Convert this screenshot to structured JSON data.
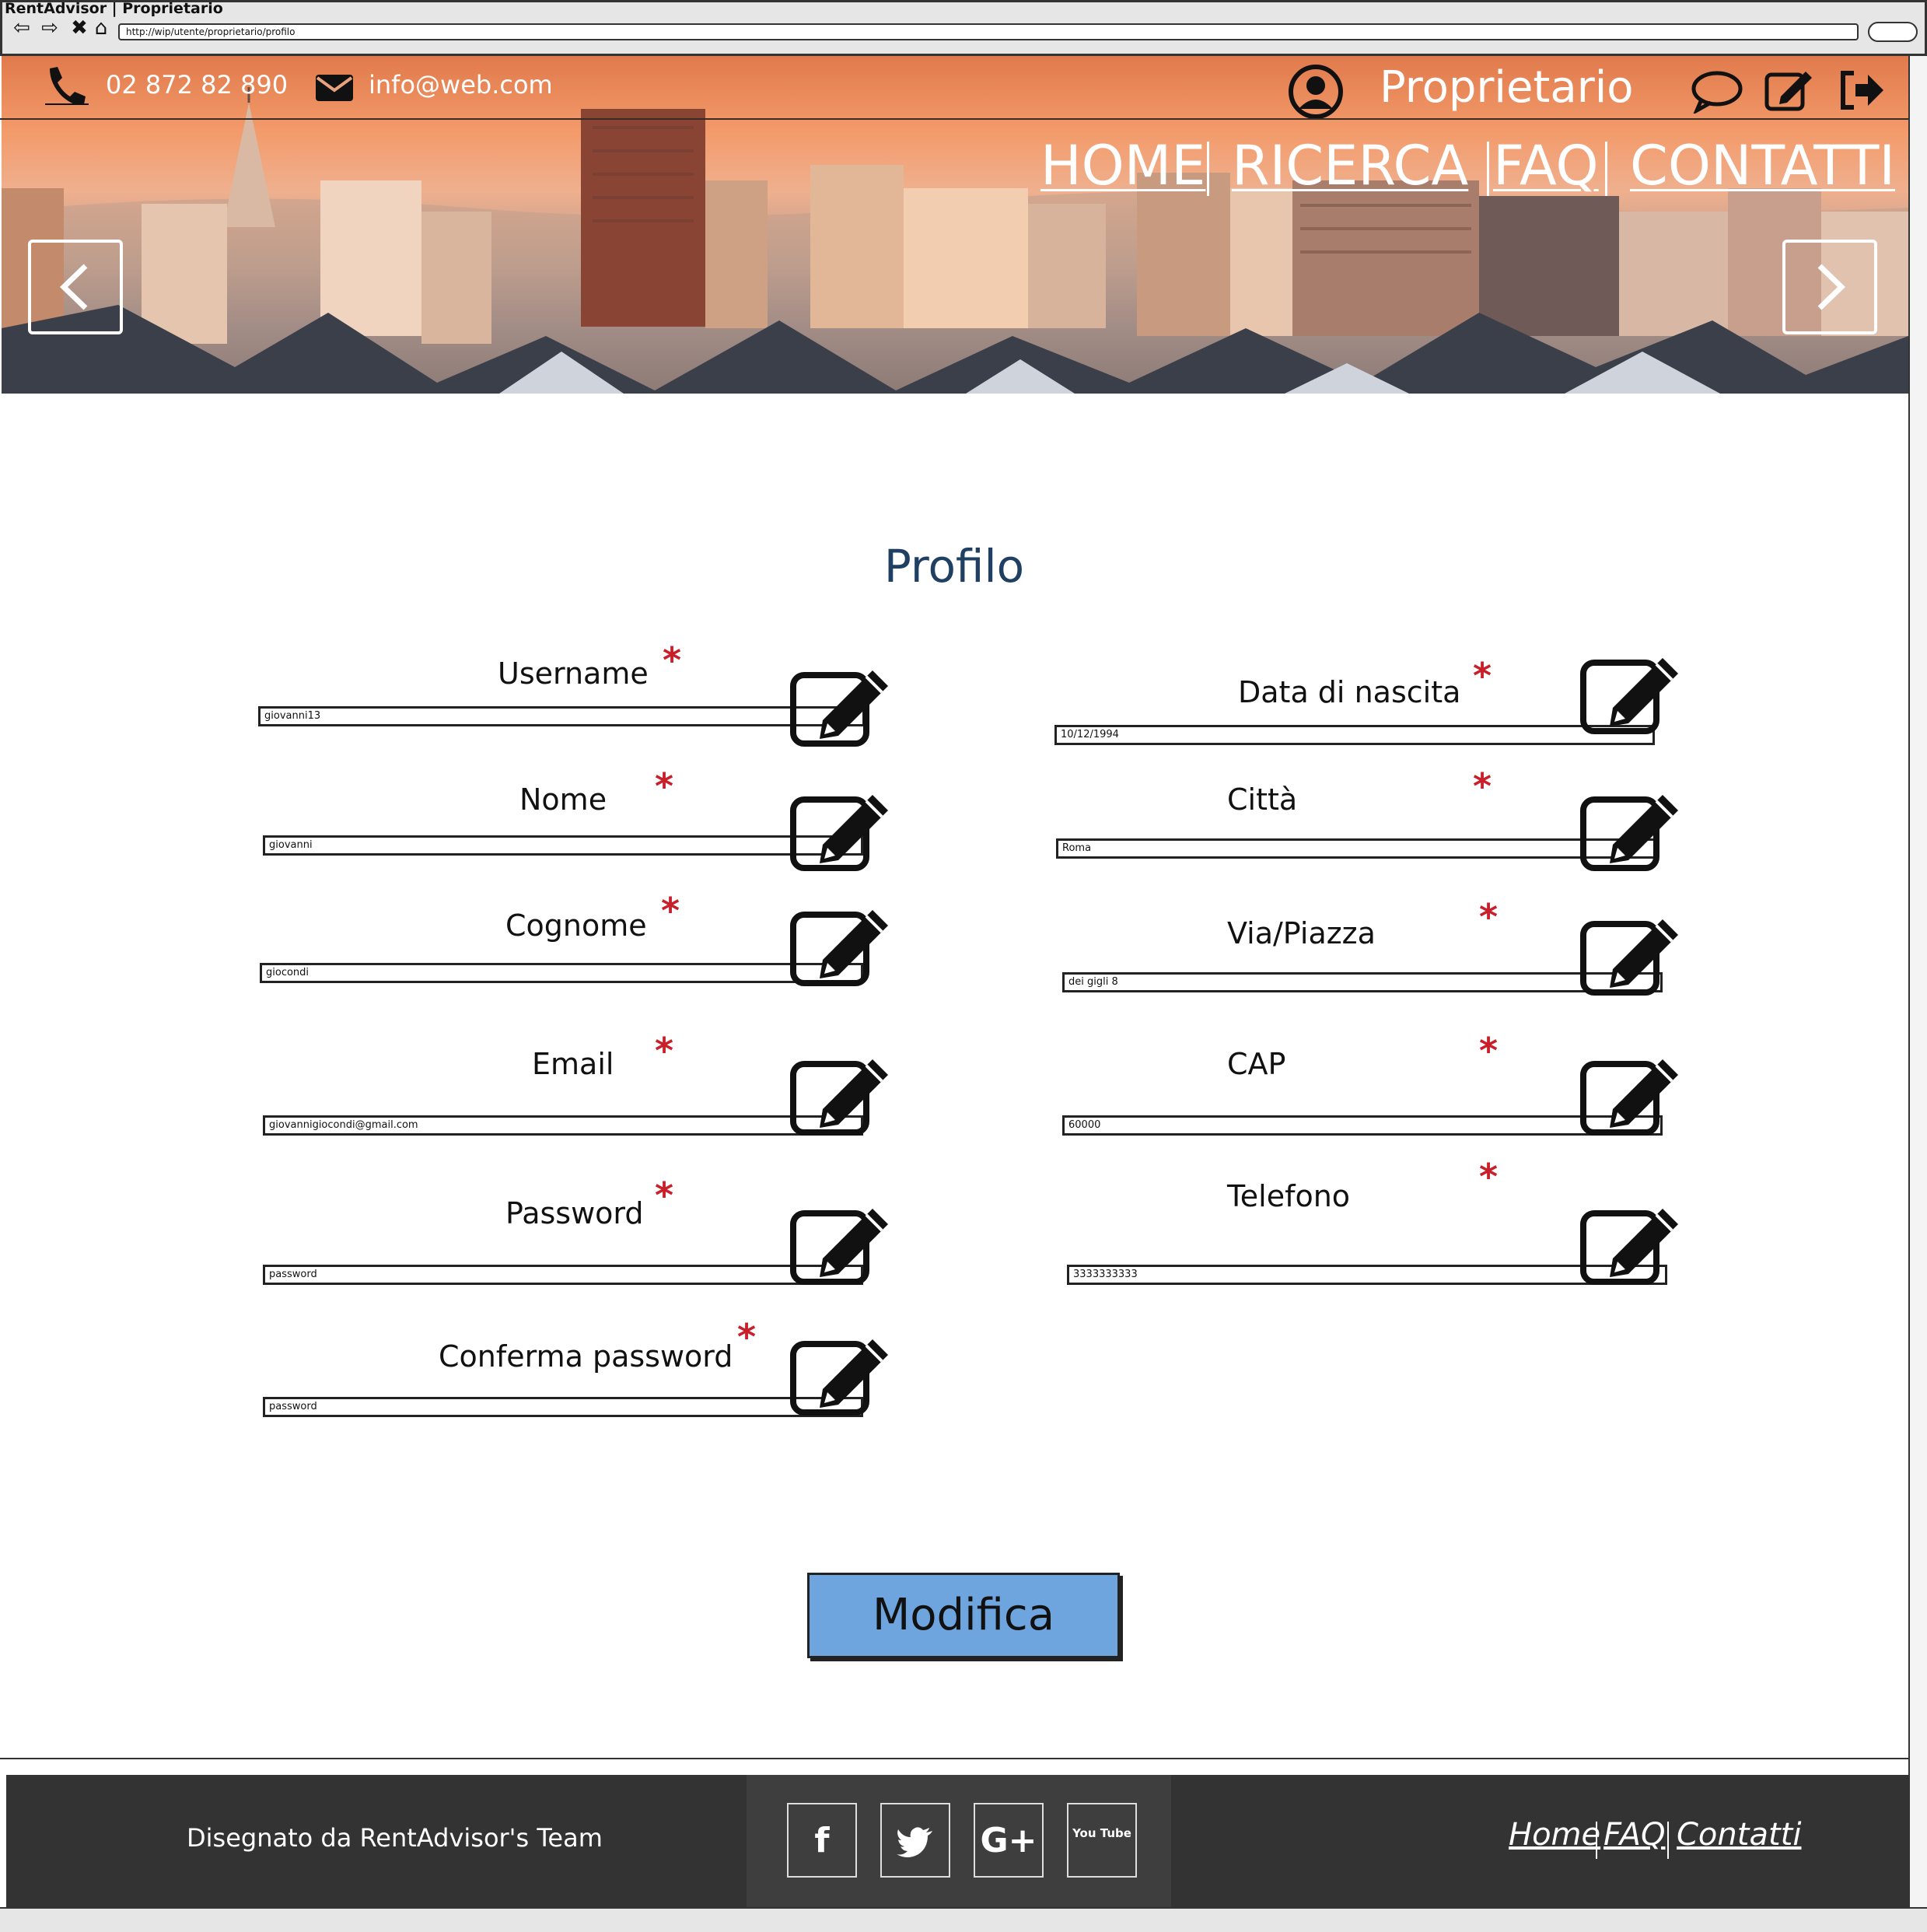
{
  "browser": {
    "window_title": "RentAdvisor | Proprietario",
    "url": "http://wip/utente/proprietario/profilo"
  },
  "header": {
    "phone": "02 872 82 890",
    "email": "info@web.com",
    "role": "Proprietario",
    "icons": [
      "phone-icon",
      "mail-icon",
      "user-icon",
      "chat-icon",
      "edit-icon",
      "logout-icon"
    ],
    "menu": [
      "HOME",
      "RICERCA",
      "FAQ",
      "CONTATTI"
    ]
  },
  "form": {
    "title": "Profilo",
    "left": [
      {
        "label": "Username",
        "value": "giovanni13"
      },
      {
        "label": "Nome",
        "value": "giovanni"
      },
      {
        "label": "Cognome",
        "value": "giocondi"
      },
      {
        "label": "Email",
        "value": "giovannigiocondi@gmail.com"
      },
      {
        "label": "Password",
        "value": "password"
      },
      {
        "label": "Conferma password",
        "value": "password"
      }
    ],
    "right": [
      {
        "label": "Data di nascita",
        "value": "10/12/1994"
      },
      {
        "label": "Città",
        "value": "Roma"
      },
      {
        "label": "Via/Piazza",
        "value": "dei gigli 8"
      },
      {
        "label": "CAP",
        "value": "60000"
      },
      {
        "label": "Telefono",
        "value": "3333333333"
      }
    ],
    "required_mark": "*",
    "submit_label": "Modifica",
    "colors": {
      "title": "#1f3f63",
      "required": "#c8202a",
      "button": "#6ea5df"
    }
  },
  "footer": {
    "credit": "Disegnato da RentAdvisor's Team",
    "social": [
      {
        "name": "facebook-icon",
        "glyph": "f"
      },
      {
        "name": "twitter-icon",
        "glyph": "🐦"
      },
      {
        "name": "google-plus-icon",
        "glyph": "G+"
      },
      {
        "name": "youtube-icon",
        "glyph": "You Tube"
      }
    ],
    "links": [
      "Home",
      "FAQ",
      "Contatti"
    ],
    "background": "#333333"
  }
}
